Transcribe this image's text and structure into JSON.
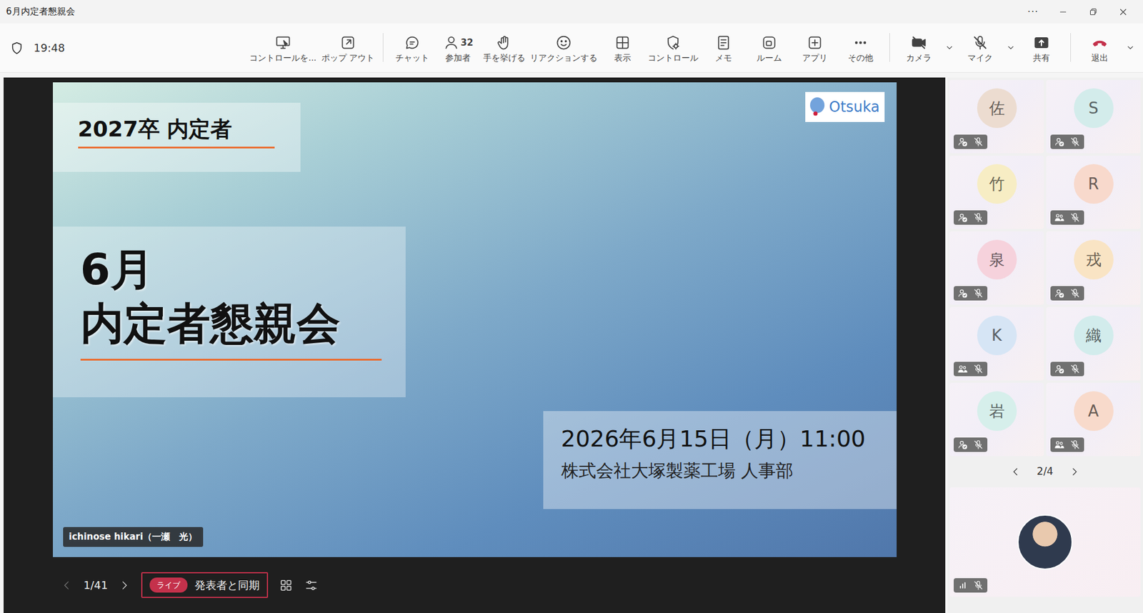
{
  "window": {
    "title": "6月内定者懇親会",
    "more": "···"
  },
  "toolbar": {
    "time": "19:48",
    "groups": [
      [
        {
          "label": "コントロールを...",
          "dropdown": false
        },
        {
          "label": "ポップ アウト",
          "dropdown": false
        }
      ],
      [
        {
          "label": "チャット",
          "dropdown": false
        },
        {
          "label": "参加者",
          "count": "32",
          "dropdown": false
        },
        {
          "label": "手を挙げる",
          "dropdown": false
        },
        {
          "label": "リアクションする",
          "dropdown": false
        },
        {
          "label": "表示",
          "dropdown": false
        },
        {
          "label": "コントロール",
          "dropdown": false
        },
        {
          "label": "メモ",
          "dropdown": false
        },
        {
          "label": "ルーム",
          "dropdown": false
        },
        {
          "label": "アプリ",
          "dropdown": false
        },
        {
          "label": "その他",
          "dropdown": false
        }
      ],
      [
        {
          "label": "カメラ",
          "on": false,
          "dropdown": true
        },
        {
          "label": "マイク",
          "on": false,
          "dropdown": true
        },
        {
          "label": "共有",
          "dropdown": false
        }
      ],
      [
        {
          "label": "退出",
          "dropdown": true
        }
      ]
    ]
  },
  "slide": {
    "logo": "Otsuka",
    "heading": "2027卒 内定者",
    "title_lines": [
      "6月",
      "内定者懇親会"
    ],
    "date": "2026年6月15日（月）11:00",
    "org": "株式会社大塚製薬工場 人事部",
    "presenter": "ichinose hikari（一瀬　光）"
  },
  "slide_controls": {
    "page": "1/41",
    "live": "ライブ",
    "sync": "発表者と同期"
  },
  "participants": {
    "tiles": [
      {
        "initial": "佐",
        "color": "#ecdcd0",
        "kind": "check",
        "muted": true
      },
      {
        "initial": "S",
        "color": "#d3eceb",
        "kind": "check",
        "muted": true
      },
      {
        "initial": "竹",
        "color": "#f7edc4",
        "kind": "check",
        "muted": true
      },
      {
        "initial": "R",
        "color": "#f8d9cc",
        "kind": "guest",
        "muted": true
      },
      {
        "initial": "泉",
        "color": "#f6d2dc",
        "kind": "check",
        "muted": true
      },
      {
        "initial": "戎",
        "color": "#f9e4c4",
        "kind": "check",
        "muted": true
      },
      {
        "initial": "K",
        "color": "#d6e5f5",
        "kind": "guest",
        "muted": true
      },
      {
        "initial": "織",
        "color": "#d2ecec",
        "kind": "check",
        "muted": true
      },
      {
        "initial": "岩",
        "color": "#d6efeb",
        "kind": "check",
        "muted": true
      },
      {
        "initial": "A",
        "color": "#f8dacb",
        "kind": "guest",
        "muted": true
      }
    ],
    "pager": "2/4"
  },
  "self_view": {
    "muted": true
  }
}
